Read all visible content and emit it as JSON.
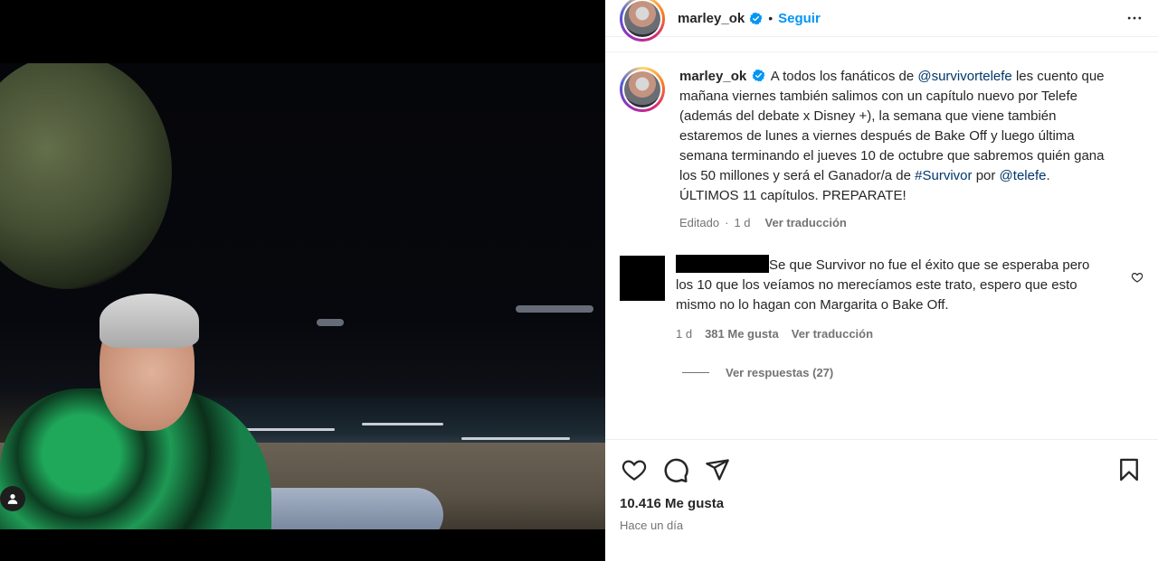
{
  "post": {
    "username": "marley_ok",
    "follow_label": "Seguir",
    "dot": "•",
    "caption": {
      "username": "marley_ok",
      "text_1": "A todos los fanáticos de",
      "mention_1": "@survivortelefe",
      "text_2": "les cuento que mañana viernes también salimos con un capítulo nuevo por Telefe (además del debate x Disney +), la semana que viene también estaremos de lunes a viernes después de Bake Off y luego última semana terminando el jueves 10 de octubre que sabremos quién gana los 50 millones y será el Ganador/a de",
      "hashtag": "#Survivor",
      "text_3": "por",
      "mention_2": "@telefe",
      "text_4": ".",
      "line_2": "ÚLTIMOS 11 capítulos. PREPARATE!",
      "edited": "Editado",
      "sep": "·",
      "age": "1 d",
      "translate": "Ver traducción"
    },
    "comment": {
      "text": "Se que Survivor no fue el éxito que se esperaba pero los 10 que los veíamos no merecíamos este trato, espero que esto mismo no lo hagan con Margarita o Bake Off.",
      "age": "1 d",
      "likes": "381 Me gusta",
      "translate": "Ver traducción",
      "replies": "Ver respuestas (27)"
    },
    "likes": "10.416 Me gusta",
    "posted": "Hace un día"
  },
  "icons": {
    "like": "heart-icon",
    "comment": "comment-icon",
    "share": "send-icon",
    "save": "bookmark-icon",
    "more": "more-icon",
    "tag": "user-tag-icon",
    "verified": "verified-badge-icon"
  },
  "colors": {
    "accent": "#0095f6",
    "mention": "#00376b",
    "secondary_text": "#737373",
    "verified": "#0095f6"
  }
}
